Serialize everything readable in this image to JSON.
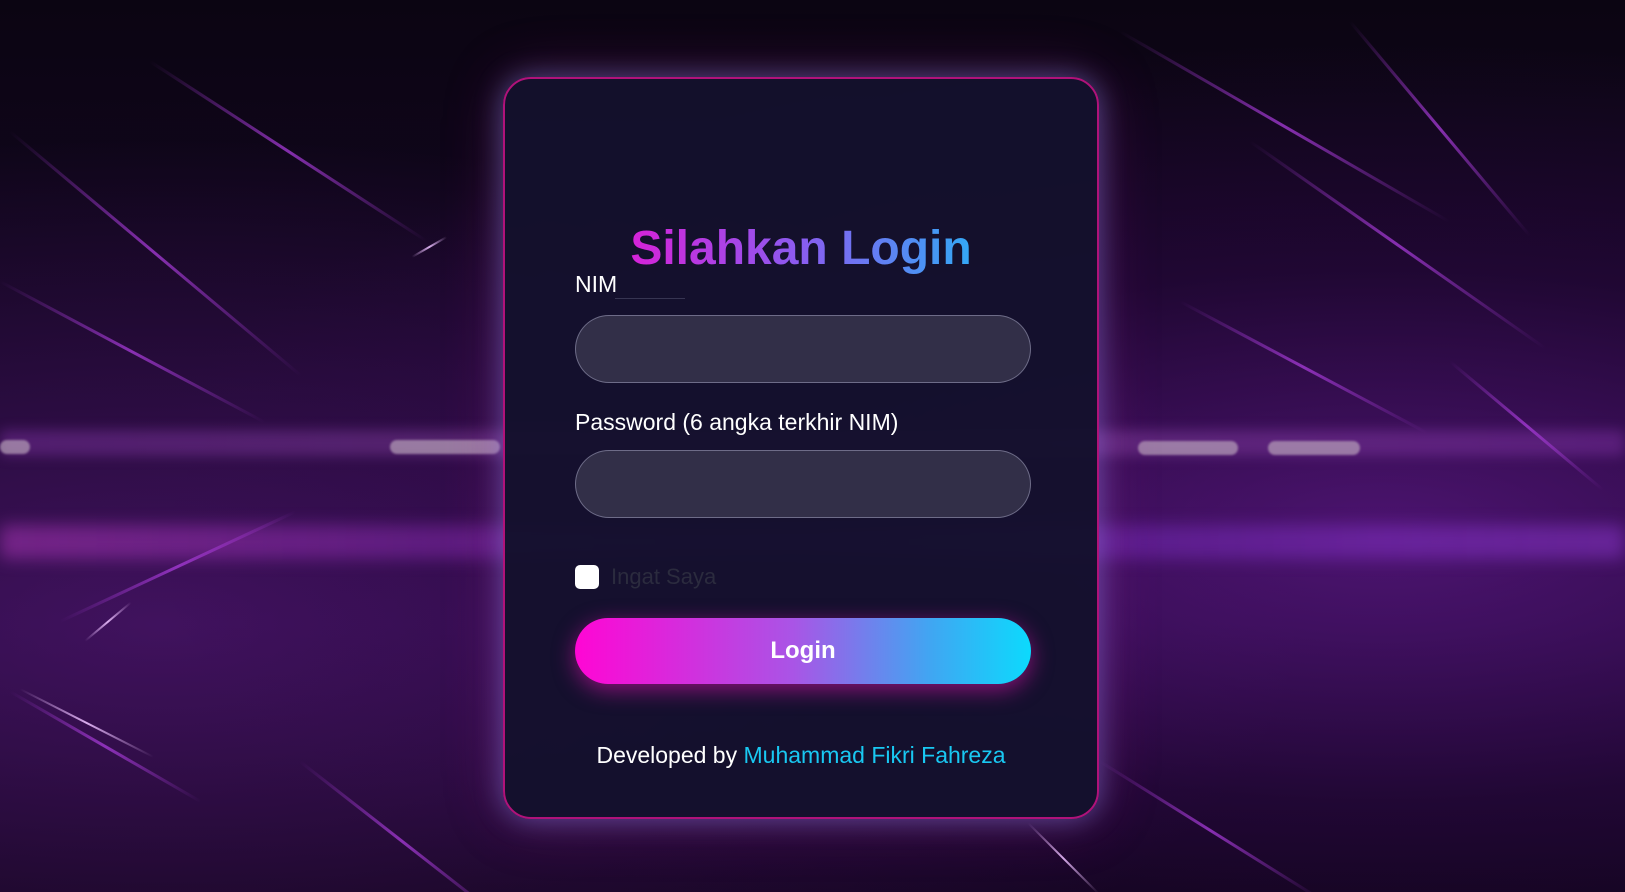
{
  "login": {
    "title": "Silahkan Login",
    "nim_label": "NIM",
    "nim_value": "",
    "password_label": "Password (6 angka terkhir NIM)",
    "password_value": "",
    "remember_label": "Ingat Saya",
    "remember_checked": false,
    "submit_label": "Login"
  },
  "footer": {
    "prefix": "Developed by",
    "author": "Muhammad Fikri Fahreza"
  },
  "colors": {
    "accent_pink": "#ff06d4",
    "accent_cyan": "#0cdafd",
    "card_border": "#b0127a",
    "link": "#19c8f2"
  }
}
